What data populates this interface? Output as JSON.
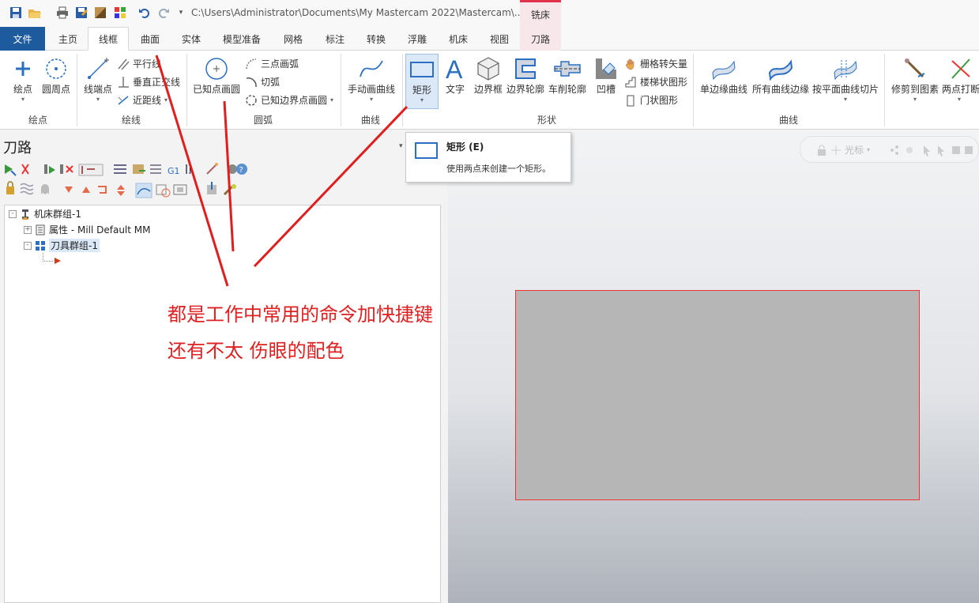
{
  "titlebar": {
    "path": "C:\\Users\\Administrator\\Documents\\My Mastercam 2022\\Mastercam\\...",
    "context_tab_group": "铣床"
  },
  "tabs": [
    "文件",
    "主页",
    "线框",
    "曲面",
    "实体",
    "模型准备",
    "网格",
    "标注",
    "转换",
    "浮雕",
    "机床",
    "视图",
    "刀路"
  ],
  "ribbon": {
    "draw_point": {
      "point": "绘点",
      "circle_center": "圆周点",
      "group": "绘点"
    },
    "draw_line": {
      "endpoints": "线端点",
      "parallel": "平行线",
      "perpendicular": "垂直正交线",
      "closest": "近距线",
      "group": "绘线"
    },
    "arc": {
      "circle_center_point": "已知点画圆",
      "three_point_arc": "三点画弧",
      "tangent_arc": "切弧",
      "circle_edge_point": "已知边界点画圆",
      "group": "圆弧"
    },
    "curve": {
      "manual_curve": "手动画曲线",
      "group": "曲线"
    },
    "shapes": {
      "rectangle": "矩形",
      "text": "文字",
      "bounding_box": "边界框",
      "boundary_profile": "边界轮廓",
      "turn_profile": "车削轮廓",
      "groove": "凹槽",
      "grid_vectors": "栅格转矢量",
      "stair": "楼梯状图形",
      "door": "门状图形",
      "group": "形状"
    },
    "curves2": {
      "single_edge": "单边缘曲线",
      "all_edges": "所有曲线边缘",
      "plane_slice": "按平面曲线切片",
      "group": "曲线"
    },
    "modify": {
      "trim": "修剪到图素",
      "two_point_break": "两点打断"
    }
  },
  "tooltip": {
    "title": "矩形 (E)",
    "description": "使用两点来创建一个矩形。"
  },
  "panel": {
    "title": "刀路"
  },
  "tree": {
    "machine_group": "机床群组-1",
    "properties": "属性 - Mill Default MM",
    "toolpath_group": "刀具群组-1"
  },
  "viewport_toolbar": {
    "cursor_label": "光标"
  },
  "annotation": {
    "line1": "都是工作中常用的命令加快捷键",
    "line2": "还有不太 伤眼的配色"
  },
  "colors": {
    "file_tab": "#1e5a9e",
    "context_tab": "#e0324a",
    "annotation": "#e02020",
    "shape_fill": "#b6b6b6"
  }
}
